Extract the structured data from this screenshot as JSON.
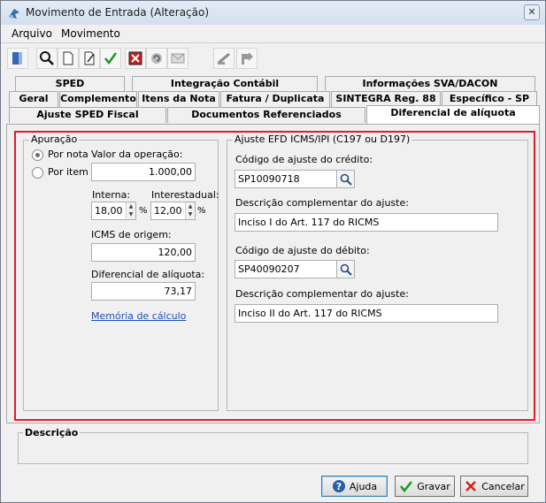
{
  "window": {
    "title": "Movimento de Entrada (Alteração)"
  },
  "menu": {
    "items": [
      "Arquivo",
      "Movimento"
    ]
  },
  "toolbar": {
    "icons": [
      "exit-icon",
      "search-icon",
      "new-document-icon",
      "edit-icon",
      "confirm-icon",
      "delete-icon",
      "copy-icon",
      "mail-icon",
      "stamp-icon",
      "export-icon"
    ]
  },
  "tabs": {
    "row1": [
      "SPED",
      "Integração Contábil",
      "Informações SVA/DACON"
    ],
    "row2": [
      "Geral",
      "Complemento",
      "Itens da Nota",
      "Fatura / Duplicata",
      "SINTEGRA Reg. 88",
      "Específico - SP"
    ],
    "row3": [
      "Ajuste SPED Fiscal",
      "Documentos Referenciados",
      "Diferencial de alíquota"
    ],
    "active": "Diferencial de alíquota"
  },
  "apuracao": {
    "legend": "Apuração",
    "options": [
      "Por nota",
      "Por item"
    ],
    "selected": "Por nota"
  },
  "valores": {
    "valor_operacao_label": "Valor da operação:",
    "valor_operacao": "1.000,00",
    "interna_label": "Interna:",
    "interna": "18,00",
    "interestadual_label": "Interestadual:",
    "interestadual": "12,00",
    "percent": "%",
    "icms_origem_label": "ICMS de origem:",
    "icms_origem": "120,00",
    "diferencial_label": "Diferencial de alíquota:",
    "diferencial": "73,17",
    "memoria_link": "Memória de cálculo"
  },
  "ajuste": {
    "legend": "Ajuste EFD ICMS/IPI (C197 ou D197)",
    "credito_label": "Código de ajuste do crédito:",
    "credito": "SP10090718",
    "desc_credito_label": "Descrição complementar do ajuste:",
    "desc_credito": "Inciso I do Art. 117 do RICMS",
    "debito_label": "Código de ajuste do débito:",
    "debito": "SP40090207",
    "desc_debito_label": "Descrição complementar do ajuste:",
    "desc_debito": "Inciso II do Art. 117 do RICMS"
  },
  "descricao": {
    "legend": "Descrição"
  },
  "buttons": {
    "help": "Ajuda",
    "save": "Gravar",
    "cancel": "Cancelar"
  },
  "colors": {
    "highlight_frame": "#e01b2b",
    "link": "#1f4fb7"
  }
}
